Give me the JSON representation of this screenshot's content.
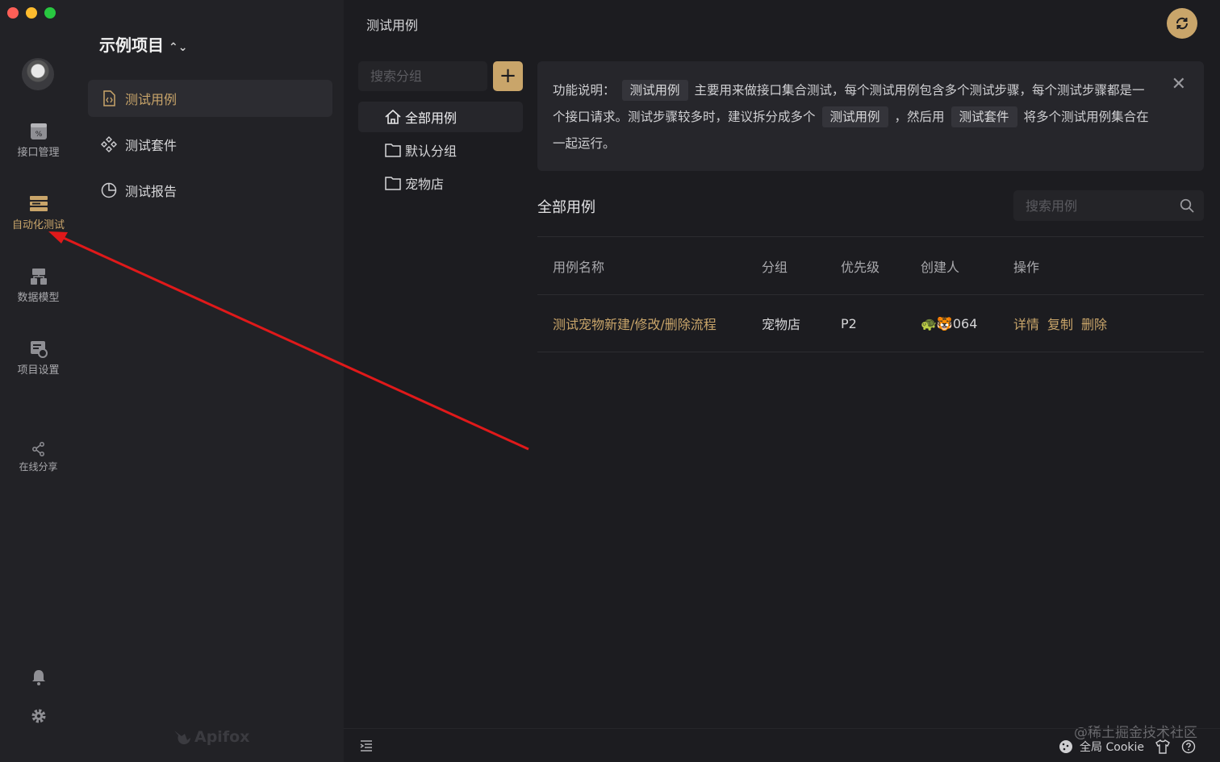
{
  "rail": {
    "items": [
      {
        "label": "接口管理",
        "icon": "api-icon"
      },
      {
        "label": "自动化测试",
        "icon": "automation-icon"
      },
      {
        "label": "数据模型",
        "icon": "data-model-icon"
      },
      {
        "label": "项目设置",
        "icon": "settings-icon"
      },
      {
        "label": "在线分享",
        "icon": "share-icon"
      }
    ]
  },
  "sidebar": {
    "project": "示例项目",
    "items": [
      {
        "label": "测试用例",
        "icon": "file-code-icon"
      },
      {
        "label": "测试套件",
        "icon": "component-icon"
      },
      {
        "label": "测试报告",
        "icon": "pie-chart-icon"
      }
    ],
    "brand": "Apifox"
  },
  "main": {
    "title": "测试用例",
    "group_search_placeholder": "搜索分组",
    "add_label": "+",
    "groups": [
      {
        "label": "全部用例",
        "icon": "home-icon"
      },
      {
        "label": "默认分组",
        "icon": "folder-icon"
      },
      {
        "label": "宠物店",
        "icon": "folder-icon"
      }
    ],
    "info": {
      "prefix": "功能说明：",
      "tag1": "测试用例",
      "text1": "主要用来做接口集合测试，每个测试用例包含多个测试步骤，每个测试步骤都是一个接口请求。测试步骤较多时，建议拆分成多个",
      "tag2": "测试用例",
      "text2": "，然后用",
      "tag3": "测试套件",
      "text3": "将多个测试用例集合在一起运行。",
      "close": "✕"
    },
    "list_title": "全部用例",
    "case_search_placeholder": "搜索用例",
    "table": {
      "headers": [
        "用例名称",
        "分组",
        "优先级",
        "创建人",
        "操作"
      ],
      "rows": [
        {
          "name": "测试宠物新建/修改/删除流程",
          "group": "宠物店",
          "priority": "P2",
          "creator": "🐢🐯064",
          "actions": [
            "详情",
            "复制",
            "删除"
          ]
        }
      ]
    }
  },
  "statusbar": {
    "cookie": "全局 Cookie",
    "watermark": "@稀土掘金技术社区"
  },
  "colors": {
    "accent": "#c9a56a",
    "annotation_arrow": "#e0191a"
  }
}
